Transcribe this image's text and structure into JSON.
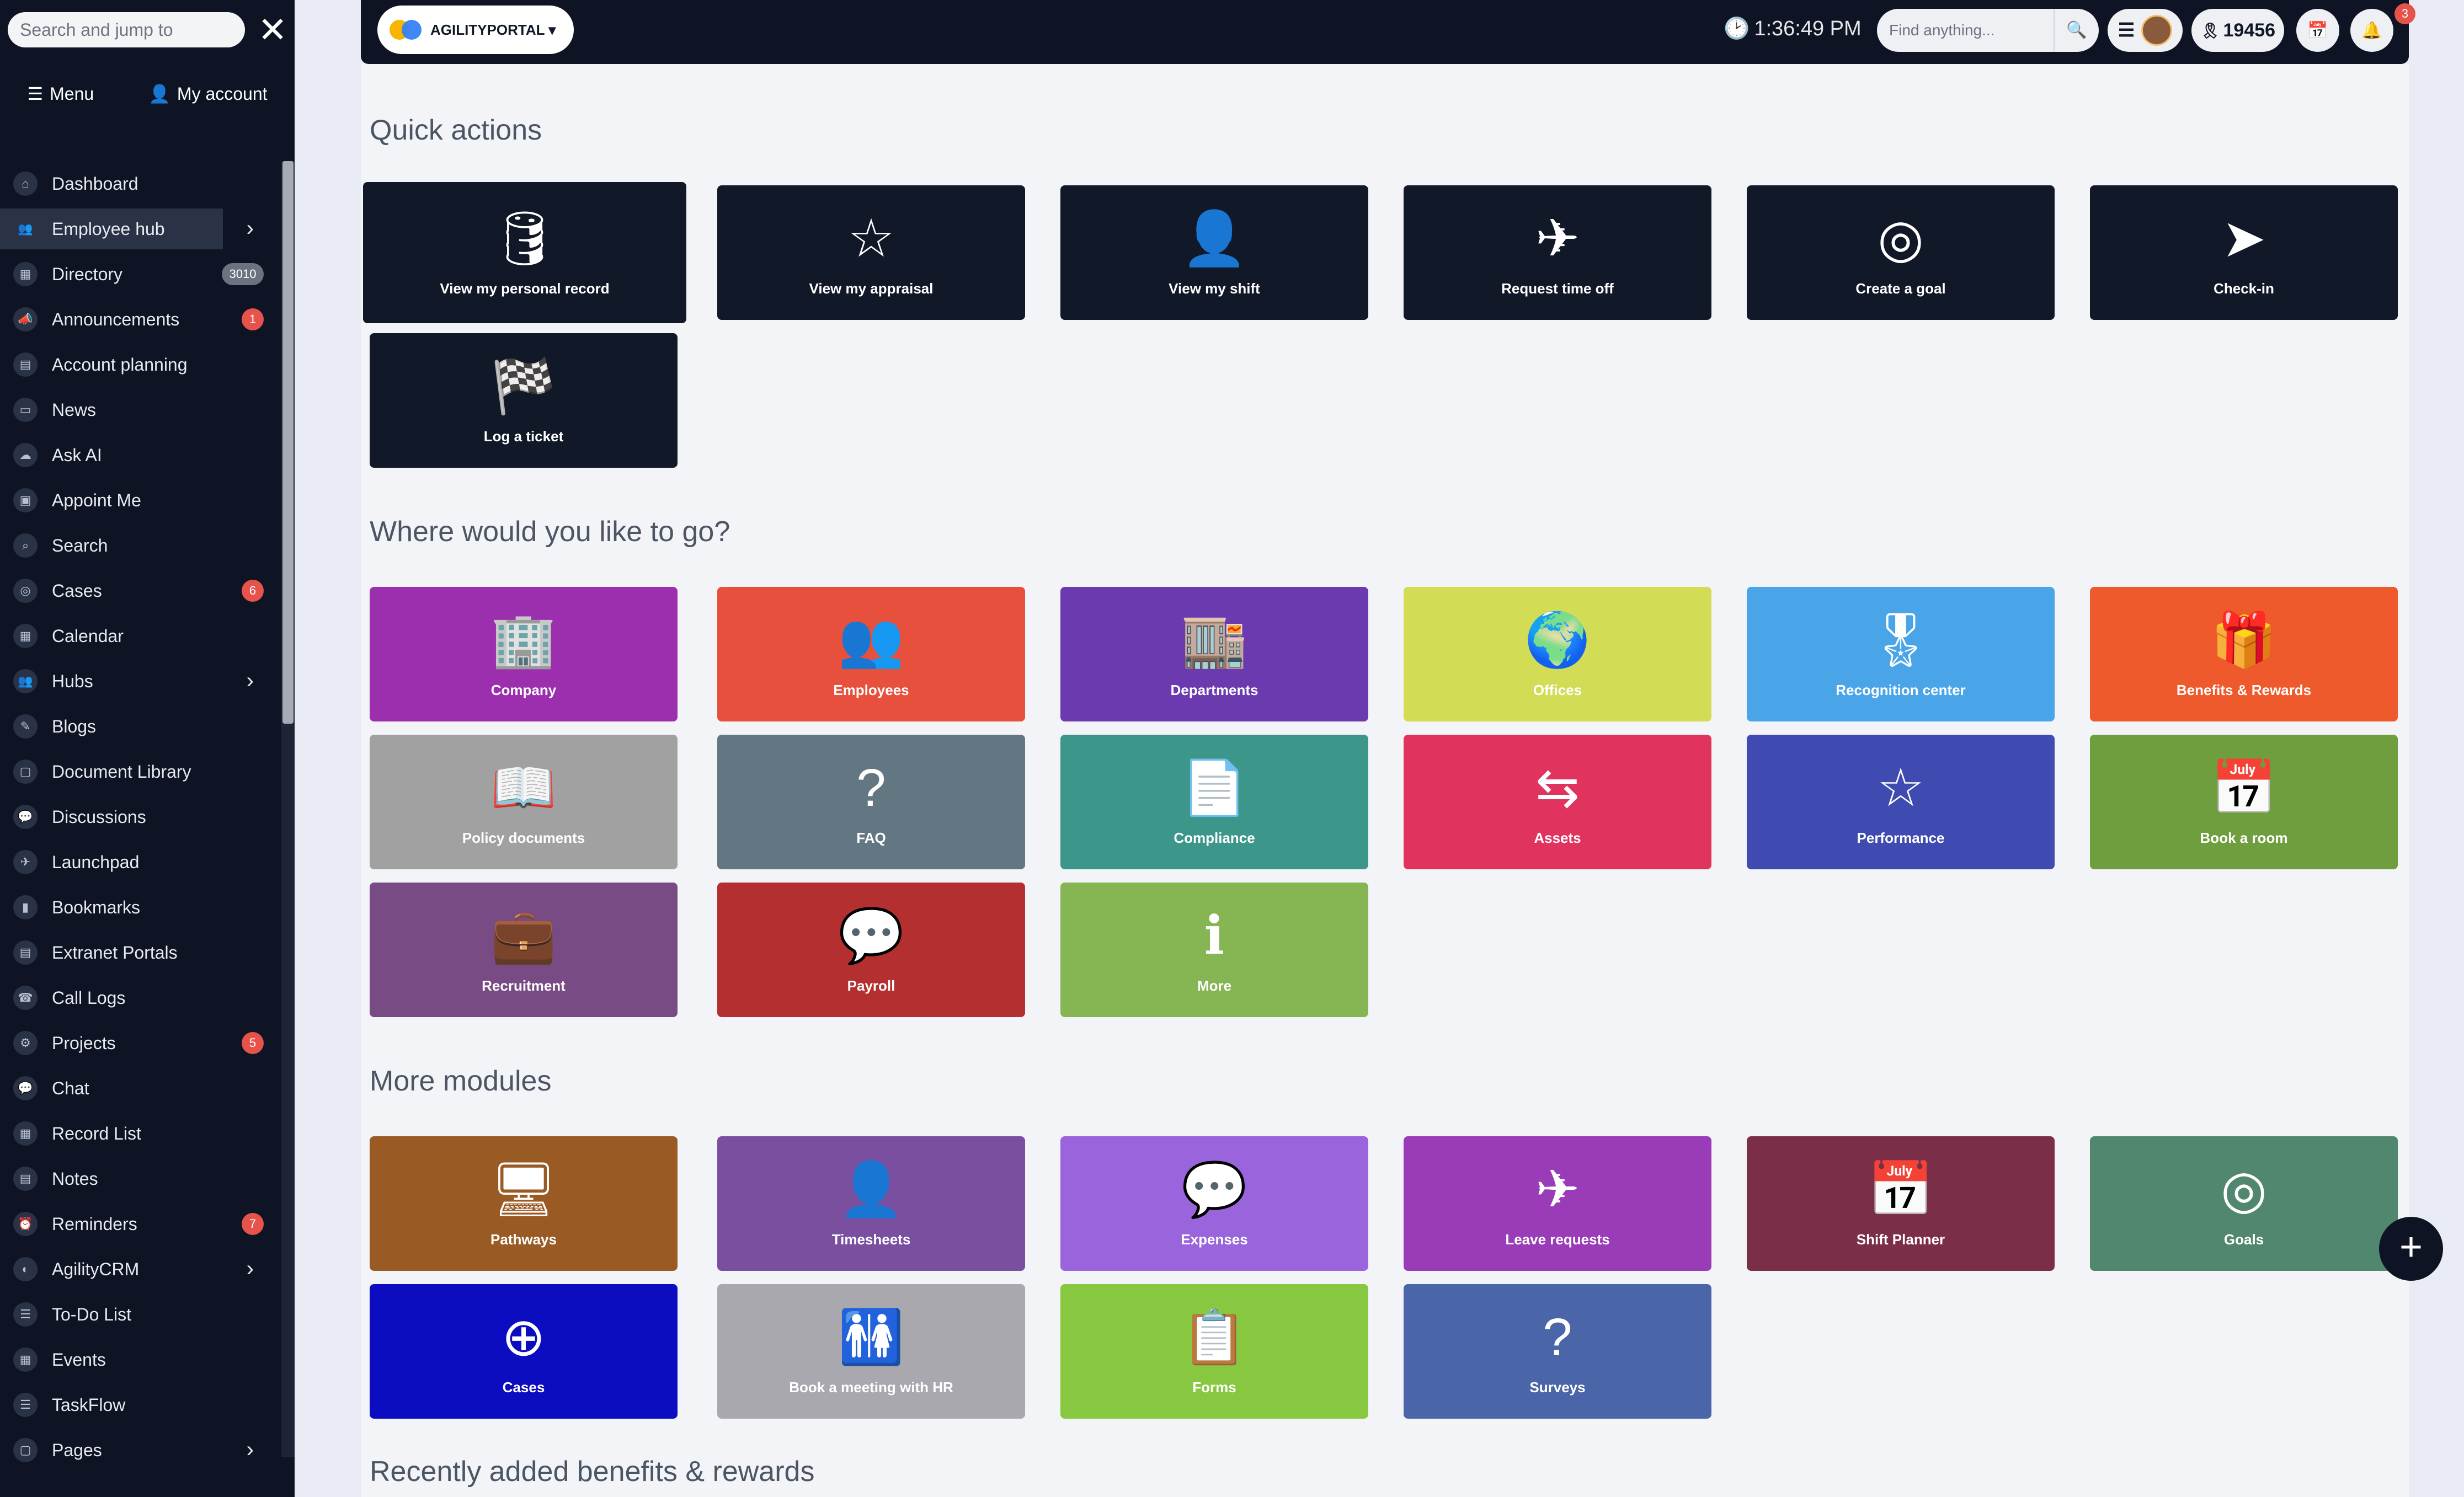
{
  "sidebar": {
    "search_placeholder": "Search and jump to",
    "close_icon": "✕",
    "tabs": [
      {
        "label": "Menu",
        "icon": "☰"
      },
      {
        "label": "My account",
        "icon": "👤"
      }
    ],
    "items": [
      {
        "label": "Dashboard",
        "icon": "⌂"
      },
      {
        "label": "Employee hub",
        "icon": "👥",
        "chevron": "›",
        "active": true
      },
      {
        "label": "Directory",
        "icon": "▦",
        "badge": "3010"
      },
      {
        "label": "Announcements",
        "icon": "📣",
        "badge": "1"
      },
      {
        "label": "Account planning",
        "icon": "▤"
      },
      {
        "label": "News",
        "icon": "▭"
      },
      {
        "label": "Ask AI",
        "icon": "☁"
      },
      {
        "label": "Appoint Me",
        "icon": "▣"
      },
      {
        "label": "Search",
        "icon": "⌕"
      },
      {
        "label": "Cases",
        "icon": "◎",
        "badge": "6"
      },
      {
        "label": "Calendar",
        "icon": "▦"
      },
      {
        "label": "Hubs",
        "icon": "👥",
        "chevron": "›"
      },
      {
        "label": "Blogs",
        "icon": "✎"
      },
      {
        "label": "Document Library",
        "icon": "▢"
      },
      {
        "label": "Discussions",
        "icon": "💬"
      },
      {
        "label": "Launchpad",
        "icon": "✈"
      },
      {
        "label": "Bookmarks",
        "icon": "▮"
      },
      {
        "label": "Extranet Portals",
        "icon": "▤"
      },
      {
        "label": "Call Logs",
        "icon": "☎"
      },
      {
        "label": "Projects",
        "icon": "⚙",
        "badge": "5"
      },
      {
        "label": "Chat",
        "icon": "💬"
      },
      {
        "label": "Record List",
        "icon": "▦"
      },
      {
        "label": "Notes",
        "icon": "▤"
      },
      {
        "label": "Reminders",
        "icon": "⏰",
        "badge": "7"
      },
      {
        "label": "AgilityCRM",
        "icon": "◐",
        "chevron": "›"
      },
      {
        "label": "To-Do List",
        "icon": "☰"
      },
      {
        "label": "Events",
        "icon": "▦"
      },
      {
        "label": "TaskFlow",
        "icon": "☰"
      },
      {
        "label": "Pages",
        "icon": "▢",
        "chevron": "›"
      }
    ]
  },
  "topbar": {
    "brand": "AGILITYPORTAL ▾",
    "time": "1:36:49 PM",
    "clock_icon": "🕑",
    "find_placeholder": "Find anything...",
    "search_icon": "🔍",
    "menu_icon": "☰",
    "points_icon": "🎗",
    "points": "19456",
    "calendar_icon": "📅",
    "bell_icon": "🔔",
    "notifications": "3"
  },
  "quick_actions": {
    "title": "Quick actions",
    "tiles": [
      {
        "label": "View my personal record",
        "icon": "🛢"
      },
      {
        "label": "View my appraisal",
        "icon": "☆"
      },
      {
        "label": "View my shift",
        "icon": "👤"
      },
      {
        "label": "Request time off",
        "icon": "✈"
      },
      {
        "label": "Create a goal",
        "icon": "◎"
      },
      {
        "label": "Check-in",
        "icon": "➤"
      },
      {
        "label": "Log a ticket",
        "icon": "🏁"
      }
    ]
  },
  "where": {
    "title": "Where would you like to go?",
    "tiles": [
      {
        "label": "Company",
        "icon": "🏢",
        "color": "#9b2fae"
      },
      {
        "label": "Employees",
        "icon": "👥",
        "color": "#e6503c"
      },
      {
        "label": "Departments",
        "icon": "🏬",
        "color": "#6a3aae"
      },
      {
        "label": "Offices",
        "icon": "🌍",
        "color": "#d2dc55"
      },
      {
        "label": "Recognition center",
        "icon": "🎖",
        "color": "#4aa5e8"
      },
      {
        "label": "Benefits & Rewards",
        "icon": "🎁",
        "color": "#ef5a2d"
      },
      {
        "label": "Policy documents",
        "icon": "📖",
        "color": "#a1a1a1"
      },
      {
        "label": "FAQ",
        "icon": "?",
        "color": "#627781"
      },
      {
        "label": "Compliance",
        "icon": "📄",
        "color": "#3d968a"
      },
      {
        "label": "Assets",
        "icon": "⇆",
        "color": "#e0335d"
      },
      {
        "label": "Performance",
        "icon": "☆",
        "color": "#3f4bb0"
      },
      {
        "label": "Book a room",
        "icon": "📅",
        "color": "#6e9e3d"
      },
      {
        "label": "Recruitment",
        "icon": "💼",
        "color": "#784b85"
      },
      {
        "label": "Payroll",
        "icon": "💬",
        "color": "#b42f30"
      },
      {
        "label": "More",
        "icon": "ℹ",
        "color": "#86b553"
      }
    ]
  },
  "more": {
    "title": "More modules",
    "tiles": [
      {
        "label": "Pathways",
        "icon": "🖥",
        "color": "#9a5a24"
      },
      {
        "label": "Timesheets",
        "icon": "👤",
        "color": "#7a4fa0"
      },
      {
        "label": "Expenses",
        "icon": "💬",
        "color": "#9a64dc"
      },
      {
        "label": "Leave requests",
        "icon": "✈",
        "color": "#9a3bb8"
      },
      {
        "label": "Shift Planner",
        "icon": "📅",
        "color": "#7b2e48"
      },
      {
        "label": "Goals",
        "icon": "◎",
        "color": "#52876f"
      },
      {
        "label": "Cases",
        "icon": "⊕",
        "color": "#0c0cc0"
      },
      {
        "label": "Book a meeting with HR",
        "icon": "🚻",
        "color": "#a8a8ae"
      },
      {
        "label": "Forms",
        "icon": "📋",
        "color": "#88c840"
      },
      {
        "label": "Surveys",
        "icon": "?",
        "color": "#4a66a8"
      }
    ]
  },
  "recent": {
    "title": "Recently added benefits & rewards"
  },
  "fab_icon": "+"
}
